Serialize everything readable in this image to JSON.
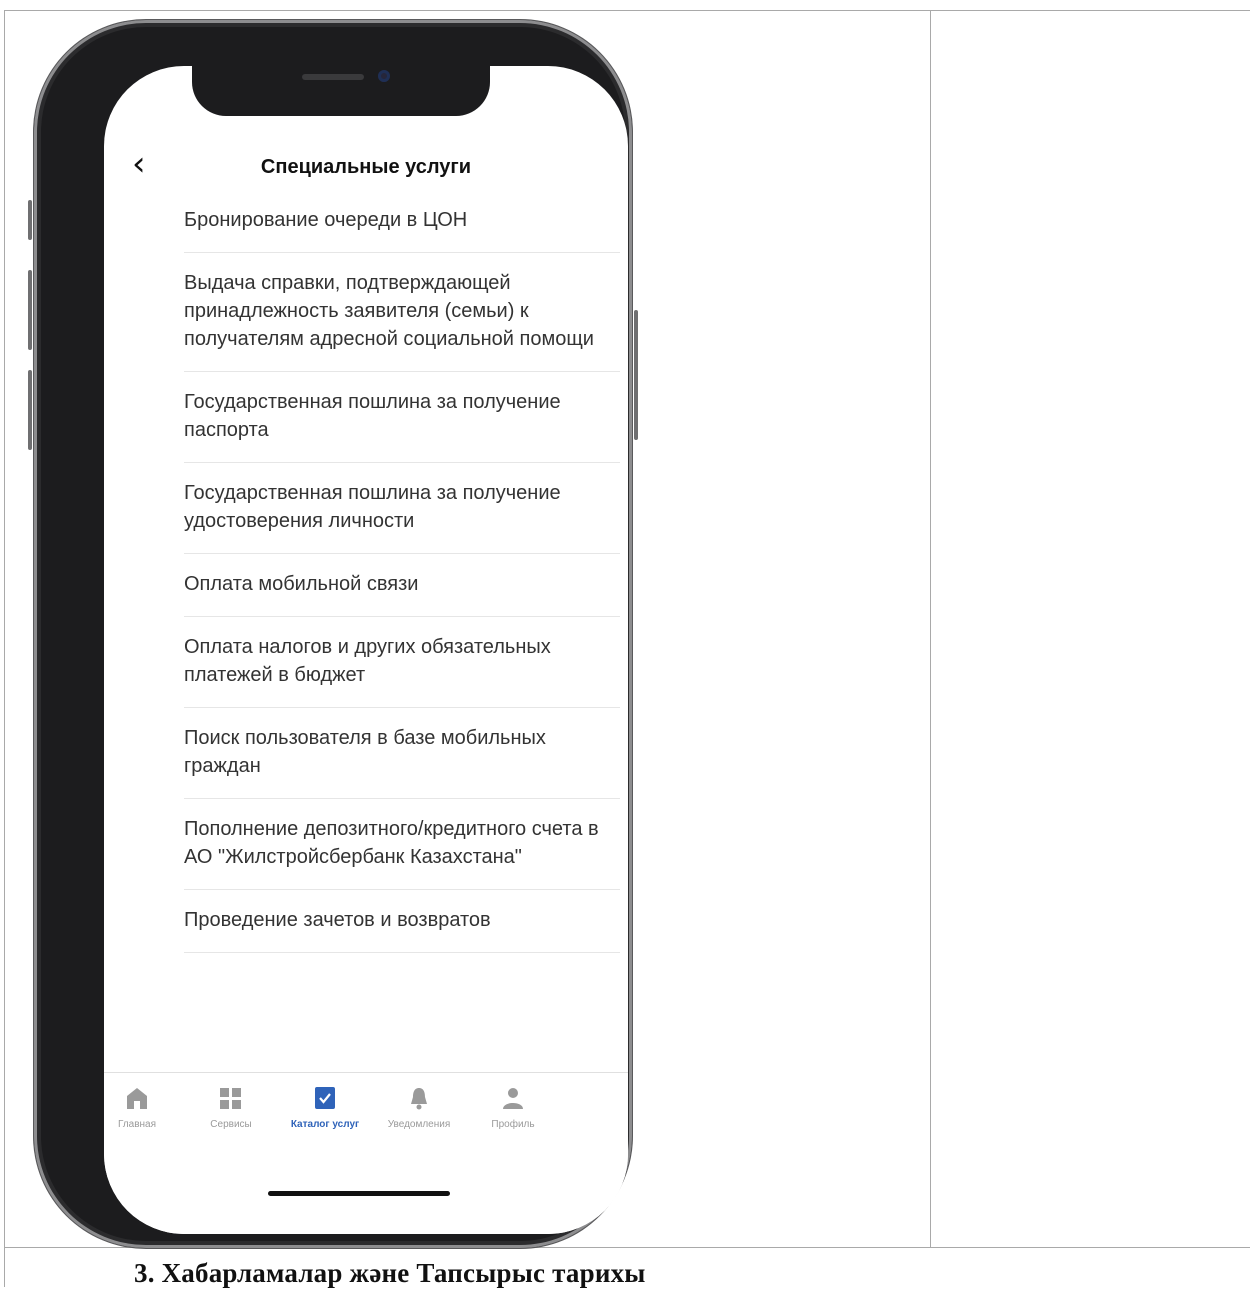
{
  "app": {
    "title": "Специальные услуги",
    "back_icon": "chevron-left-icon"
  },
  "services": [
    {
      "label": "Бронирование очереди в ЦОН"
    },
    {
      "label": "Выдача справки, подтверждающей принадлежность заявителя (семьи) к получателям адресной социальной помощи"
    },
    {
      "label": "Государственная пошлина за получение паспорта"
    },
    {
      "label": "Государственная пошлина за получение удостоверения личности"
    },
    {
      "label": "Оплата мобильной связи"
    },
    {
      "label": "Оплата налогов и других обязательных платежей в бюджет"
    },
    {
      "label": "Поиск пользователя в базе мобильных граждан"
    },
    {
      "label": "Пополнение депозитного/кредитного счета в АО \"Жилстройсбербанк Казахстана\""
    },
    {
      "label": "Проведение зачетов и возвратов"
    }
  ],
  "tabbar": {
    "items": [
      {
        "label": "Главная",
        "icon": "home-icon",
        "active": false
      },
      {
        "label": "Сервисы",
        "icon": "grid-icon",
        "active": false
      },
      {
        "label": "Каталог услуг",
        "icon": "checkbox-icon",
        "active": true
      },
      {
        "label": "Уведомления",
        "icon": "bell-icon",
        "active": false
      },
      {
        "label": "Профиль",
        "icon": "person-icon",
        "active": false
      }
    ]
  },
  "document": {
    "heading": "3. Хабарламалар және Тапсырыс тарихы"
  },
  "colors": {
    "accent": "#2f63b9",
    "inactive": "#9a9a9a",
    "text": "#333333",
    "frame": "#1c1c1e"
  }
}
